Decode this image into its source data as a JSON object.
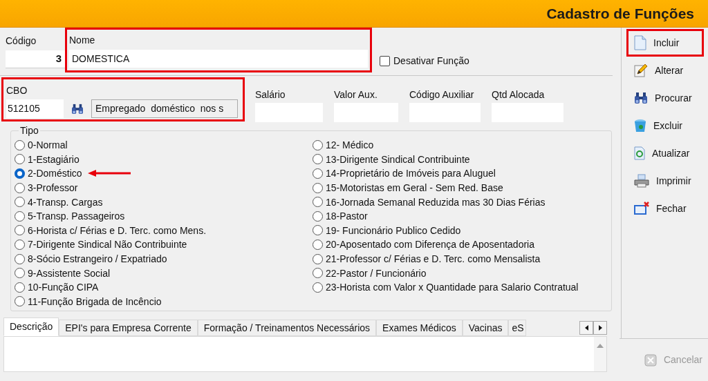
{
  "window": {
    "title": "Cadastro de Funções"
  },
  "form": {
    "codigo": {
      "label": "Código",
      "value": "3"
    },
    "nome": {
      "label": "Nome",
      "value": "DOMESTICA",
      "highlighted": true
    },
    "desativar": {
      "label": "Desativar Função",
      "checked": false
    },
    "cbo": {
      "label": "CBO",
      "value": "512105",
      "description": "Empregado  doméstico  nos s",
      "highlighted": true
    },
    "fields": [
      {
        "label": "Salário"
      },
      {
        "label": "Valor Aux."
      },
      {
        "label": "Código Auxiliar"
      },
      {
        "label": "Qtd Alocada"
      }
    ]
  },
  "tipo": {
    "label": "Tipo",
    "columns": [
      [
        {
          "label": "0-Normal",
          "selected": false
        },
        {
          "label": "1-Estagiário",
          "selected": false
        },
        {
          "label": "2-Doméstico",
          "selected": true,
          "annotated": true
        },
        {
          "label": "3-Professor",
          "selected": false
        },
        {
          "label": "4-Transp. Cargas",
          "selected": false
        },
        {
          "label": "5-Transp. Passageiros",
          "selected": false
        },
        {
          "label": "6-Horista c/ Férias e D. Terc. como Mens.",
          "selected": false
        },
        {
          "label": "7-Dirigente Sindical Não Contribuinte",
          "selected": false
        },
        {
          "label": "8-Sócio Estrangeiro / Expatriado",
          "selected": false
        },
        {
          "label": "9-Assistente Social",
          "selected": false
        },
        {
          "label": "10-Função CIPA",
          "selected": false
        },
        {
          "label": "11-Função Brigada de Incêncio",
          "selected": false
        }
      ],
      [
        {
          "label": "12- Médico",
          "selected": false
        },
        {
          "label": "13-Dirigente Sindical Contribuinte",
          "selected": false
        },
        {
          "label": "14-Proprietário de Imóveis para Aluguel",
          "selected": false
        },
        {
          "label": "15-Motoristas em Geral - Sem Red. Base",
          "selected": false
        },
        {
          "label": "16-Jornada Semanal Reduzida mas 30 Dias Férias",
          "selected": false
        },
        {
          "label": "18-Pastor",
          "selected": false
        },
        {
          "label": "19- Funcionário Publico Cedido",
          "selected": false
        },
        {
          "label": "20-Aposentado com Diferença de Aposentadoria",
          "selected": false
        },
        {
          "label": "21-Professor c/ Férias e D. Terc. como Mensalista",
          "selected": false
        },
        {
          "label": "22-Pastor / Funcionário",
          "selected": false
        },
        {
          "label": "23-Horista com Valor x Quantidade para Salario Contratual",
          "selected": false
        }
      ]
    ]
  },
  "tabs": [
    {
      "label": "Descrição",
      "selected": true
    },
    {
      "label": "EPI's para Empresa Corrente",
      "selected": false
    },
    {
      "label": "Formação / Treinamentos Necessários",
      "selected": false
    },
    {
      "label": "Exames Médicos",
      "selected": false
    },
    {
      "label": "Vacinas",
      "selected": false
    },
    {
      "label": "eS",
      "selected": false
    }
  ],
  "toolbar": [
    {
      "label": "Incluir",
      "disabled": false,
      "highlighted": true
    },
    {
      "label": "Alterar",
      "disabled": false,
      "highlighted": false
    },
    {
      "label": "Procurar",
      "disabled": false,
      "highlighted": false
    },
    {
      "label": "Excluir",
      "disabled": false,
      "highlighted": false
    },
    {
      "label": "Atualizar",
      "disabled": false,
      "highlighted": false
    },
    {
      "label": "Imprimir",
      "disabled": false,
      "highlighted": false
    },
    {
      "label": "Fechar",
      "disabled": false,
      "highlighted": false
    }
  ],
  "cancel": {
    "label": "Cancelar",
    "disabled": true
  }
}
